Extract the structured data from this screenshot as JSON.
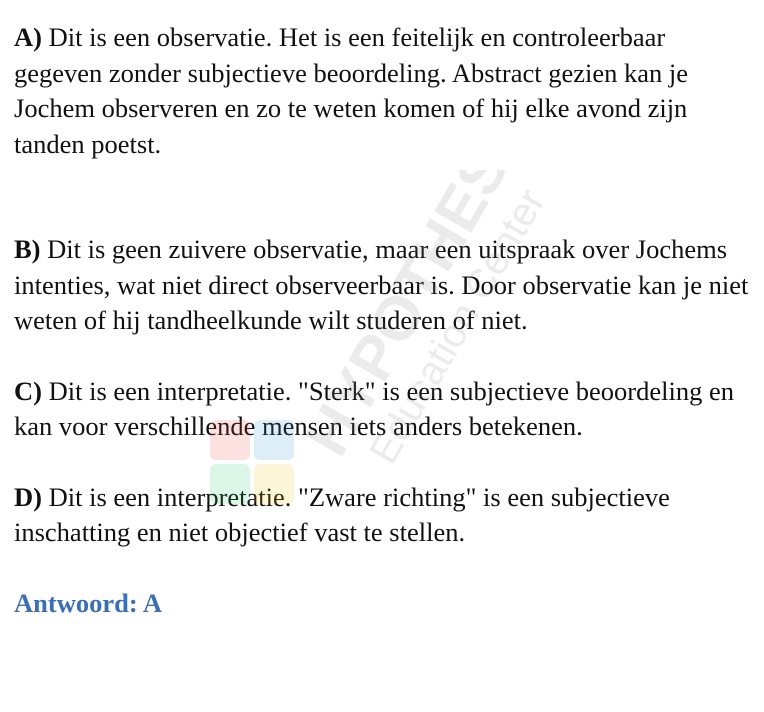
{
  "options": [
    {
      "label": "A)",
      "text": " Dit is een observatie. Het is een feitelijk en controleerbaar gegeven zonder subjectieve beoordeling. Abstract gezien kan je Jochem observeren en zo te weten komen of hij elke avond zijn tanden poetst."
    },
    {
      "label": "B)",
      "text": " Dit is geen zuivere observatie, maar een uitspraak over Jochems intenties, wat niet direct observeerbaar is. Door observatie kan je niet weten of hij tandheelkunde wilt studeren of niet."
    },
    {
      "label": "C)",
      "text": " Dit is een interpretatie. \"Sterk\" is een subjectieve beoordeling en kan voor verschillende mensen iets anders betekenen."
    },
    {
      "label": "D)",
      "text": " Dit is een interpretatie. \"Zware richting\" is een subjectieve inschatting en niet objectief vast te stellen."
    }
  ],
  "answer": "Antwoord: A",
  "watermark": {
    "brand": "HYPOTHESE",
    "tagline": "Education Center"
  },
  "colors": {
    "text": "#111111",
    "answer": "#3a6fb5",
    "watermark": "#8a8a8a"
  }
}
